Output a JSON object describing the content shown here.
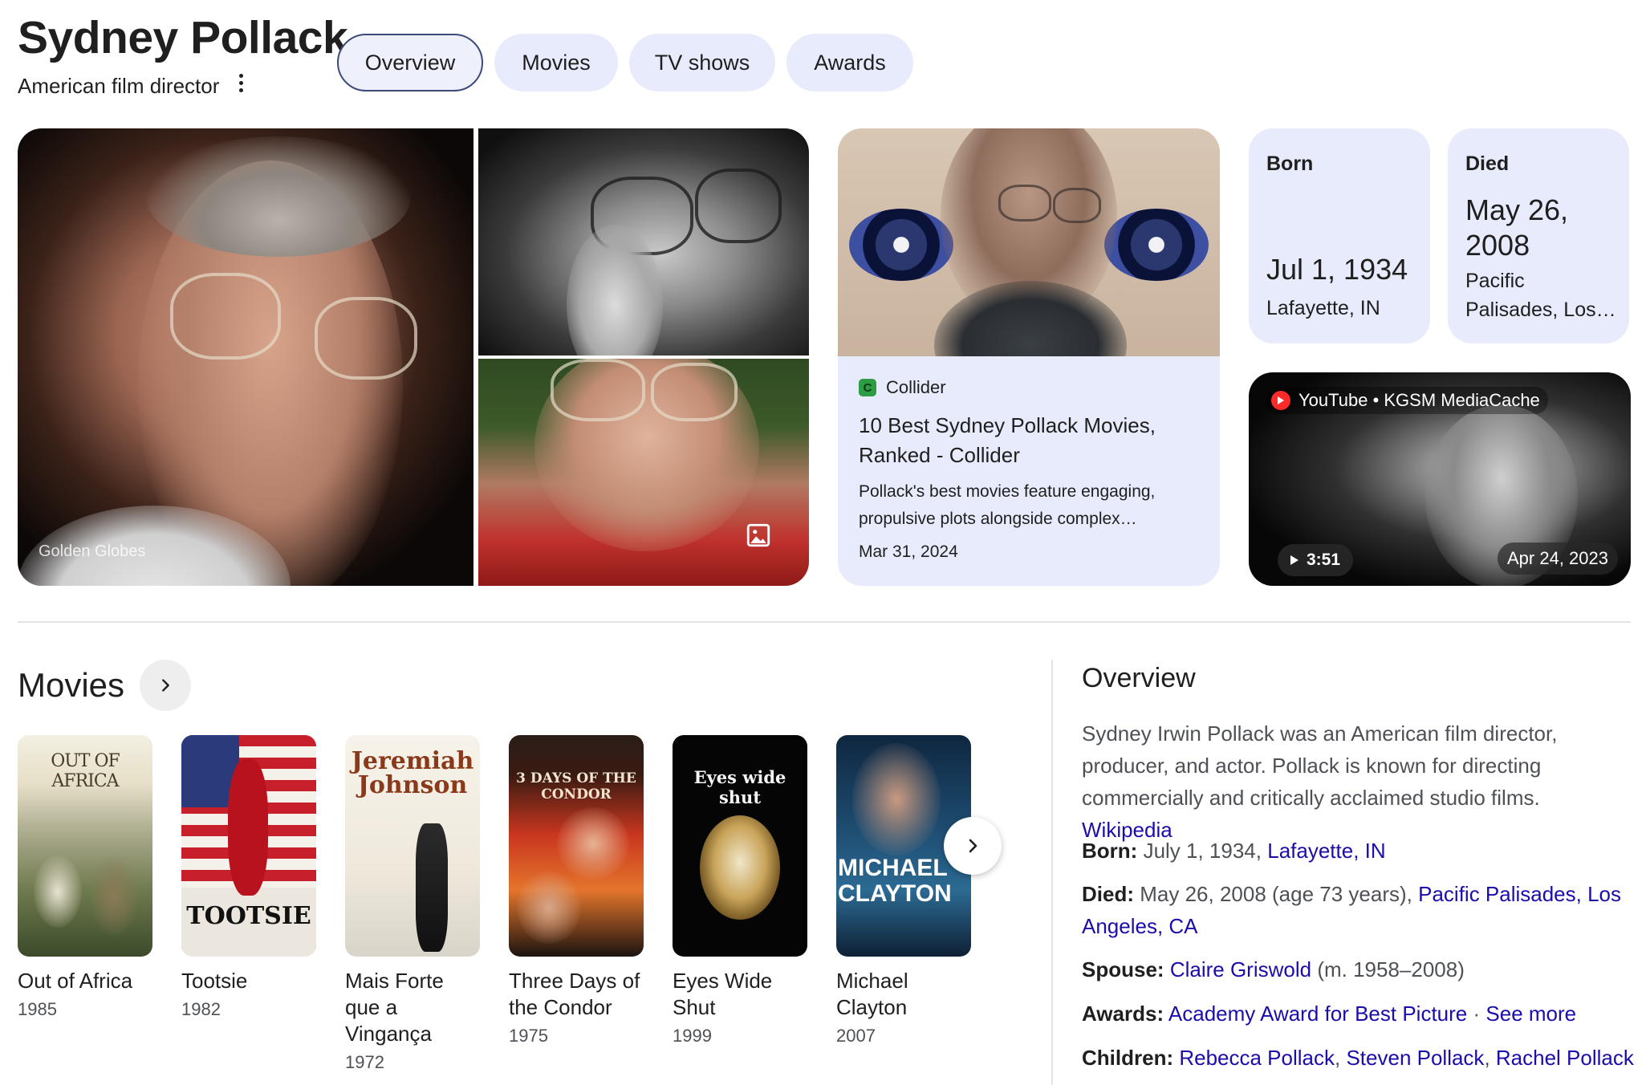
{
  "header": {
    "title": "Sydney Pollack",
    "subtitle": "American film director",
    "tabs": [
      {
        "label": "Overview",
        "active": true
      },
      {
        "label": "Movies",
        "active": false
      },
      {
        "label": "TV shows",
        "active": false
      },
      {
        "label": "Awards",
        "active": false
      }
    ]
  },
  "gallery": {
    "credit": "Golden Globes",
    "icon": "image-icon"
  },
  "article": {
    "source": "Collider",
    "source_icon": "C",
    "title": "10 Best Sydney Pollack Movies, Ranked - Collider",
    "description": "Pollack's best movies feature engaging, propulsive plots alongside complex…",
    "date": "Mar 31, 2024"
  },
  "born": {
    "label": "Born",
    "date": "Jul 1, 1934",
    "place": "Lafayette, IN"
  },
  "died": {
    "label": "Died",
    "date": "May 26, 2008",
    "place": "Pacific Palisades, Los…"
  },
  "video": {
    "source": "YouTube • KGSM MediaCache",
    "duration": "3:51",
    "date": "Apr 24, 2023"
  },
  "movies": {
    "heading": "Movies",
    "items": [
      {
        "title": "Out of Africa",
        "year": "1985",
        "poster_text": "OUT OF AFRICA"
      },
      {
        "title": "Tootsie",
        "year": "1982",
        "poster_text": "TOOTSIE"
      },
      {
        "title": "Mais Forte que a Vingança",
        "year": "1972",
        "poster_text": "Jeremiah Johnson"
      },
      {
        "title": "Three Days of the Condor",
        "year": "1975",
        "poster_text": "3 DAYS OF THE CONDOR"
      },
      {
        "title": "Eyes Wide Shut",
        "year": "1999",
        "poster_text": "Eyes wide shut"
      },
      {
        "title": "Michael Clayton",
        "year": "2007",
        "poster_text": "MICHAEL CLAYTON"
      }
    ]
  },
  "overview": {
    "heading": "Overview",
    "description": "Sydney Irwin Pollack was an American film director, producer, and actor. Pollack is known for directing commercially and critically acclaimed studio films.",
    "description_link": "Wikipedia",
    "born_label": "Born:",
    "born_text": "July 1, 1934,",
    "born_link": "Lafayette, IN",
    "died_label": "Died:",
    "died_text": "May 26, 2008 (age 73 years),",
    "died_link": "Pacific Palisades, Los Angeles, CA",
    "spouse_label": "Spouse:",
    "spouse_link": "Claire Griswold",
    "spouse_text": "(m. 1958–2008)",
    "awards_label": "Awards:",
    "awards_link": "Academy Award for Best Picture",
    "awards_sep": "·",
    "awards_more": "See more",
    "children_label": "Children:",
    "children": [
      "Rebecca Pollack",
      "Steven Pollack",
      "Rachel Pollack"
    ]
  }
}
